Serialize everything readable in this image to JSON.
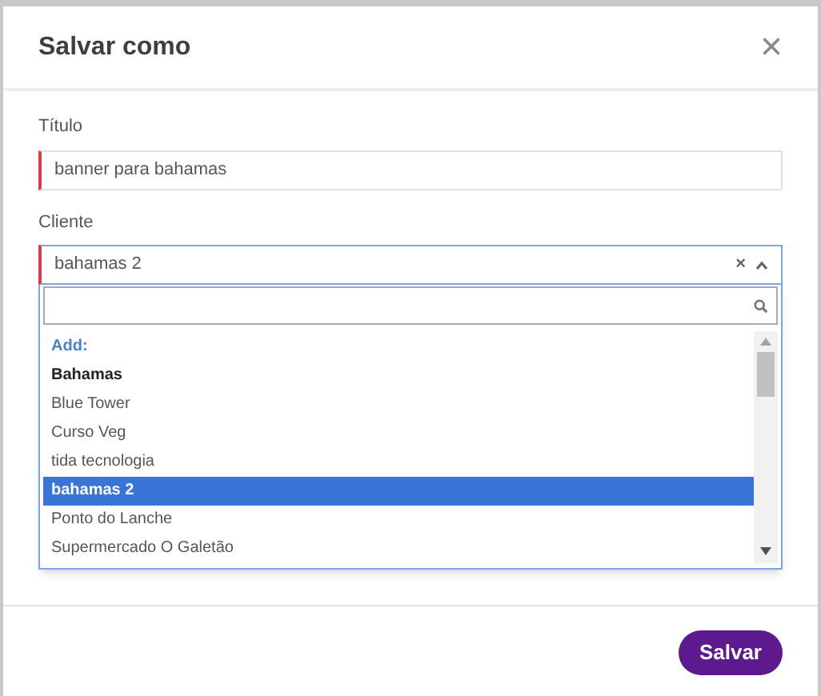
{
  "dialog": {
    "title": "Salvar como",
    "close_label": "×"
  },
  "fields": [
    {
      "label": "Título",
      "value": "banner para bahamas",
      "invalid": true
    }
  ],
  "client_select": {
    "label": "Cliente",
    "value": "bahamas 2",
    "invalid": true,
    "expanded": true,
    "clear_label": "×",
    "options": [
      {
        "kind": "header",
        "text": "Add:",
        "selected": false
      },
      {
        "kind": "add",
        "text": "Bahamas",
        "selected": false
      },
      {
        "kind": "option",
        "text": "Blue Tower",
        "selected": false
      },
      {
        "kind": "option",
        "text": "Curso Veg",
        "selected": false
      },
      {
        "kind": "option",
        "text": "tida tecnologia",
        "selected": false
      },
      {
        "kind": "option",
        "text": "bahamas 2",
        "selected": true
      },
      {
        "kind": "option",
        "text": "Ponto do Lanche",
        "selected": false
      },
      {
        "kind": "option",
        "text": "Supermercado O Galetão",
        "selected": false
      }
    ]
  },
  "save_button": "Salvar"
}
